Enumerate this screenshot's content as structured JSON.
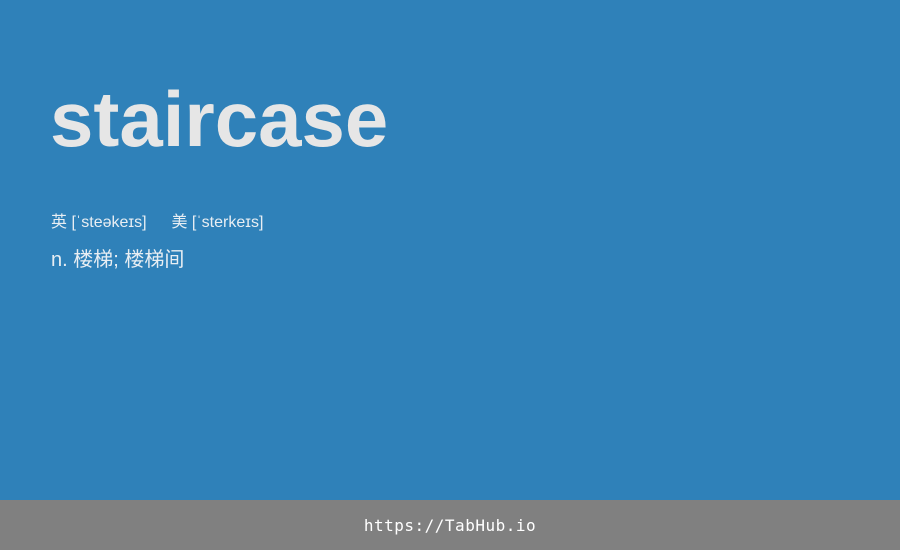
{
  "card": {
    "word": "staircase",
    "phonetic_uk_label": "英",
    "phonetic_uk": "[ˈsteəkeɪs]",
    "phonetic_us_label": "美",
    "phonetic_us": "[ˈsterkeɪs]",
    "definition": "n. 楼梯; 楼梯间"
  },
  "footer": {
    "link_text": "https://TabHub.io"
  },
  "colors": {
    "background": "#2f81b9",
    "footer": "#808080",
    "word_text": "#e6e6e6"
  }
}
